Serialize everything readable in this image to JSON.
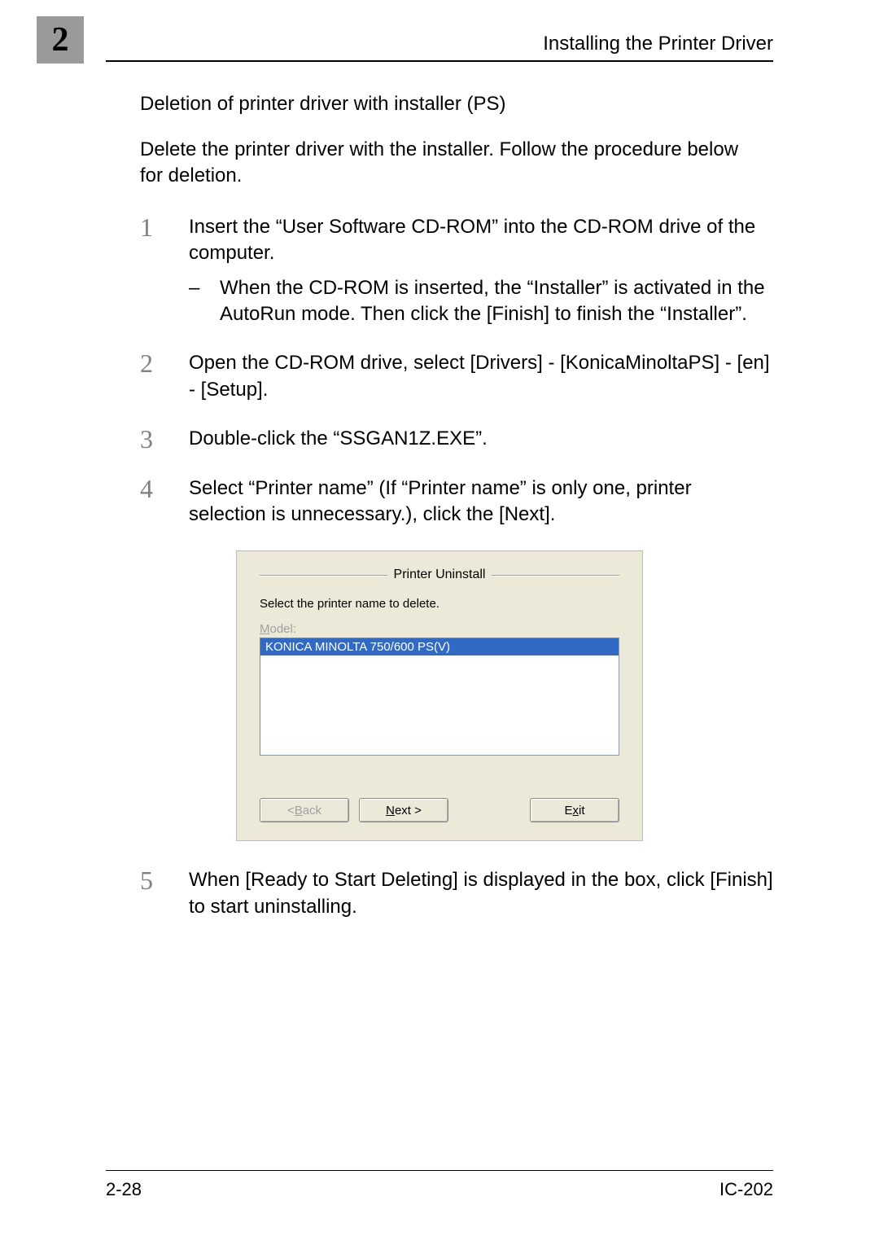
{
  "page_tab": "2",
  "header_title": "Installing the Printer Driver",
  "section_title": "Deletion of printer driver with installer (PS)",
  "intro": "Delete the printer driver with the installer. Follow the procedure below for deletion.",
  "steps": [
    {
      "num": "1",
      "text": "Insert the “User Software CD-ROM” into the CD-ROM drive of the computer.",
      "sub": "When the CD-ROM is inserted, the “Installer” is activated in the AutoRun mode. Then click the [Finish] to finish the “Installer”."
    },
    {
      "num": "2",
      "text": "Open the CD-ROM drive, select [Drivers] - [KonicaMinoltaPS] - [en] - [Setup]."
    },
    {
      "num": "3",
      "text": "Double-click the “SSGAN1Z.EXE”."
    },
    {
      "num": "4",
      "text": "Select “Printer name” (If “Printer name” is only one, printer selection is unnecessary.), click the [Next]."
    }
  ],
  "step5": {
    "num": "5",
    "text": "When [Ready to Start Deleting] is displayed in the box, click [Finish] to start uninstalling."
  },
  "dialog": {
    "title": "Printer Uninstall",
    "subtitle": "Select the printer name to delete.",
    "model_label_pre": "M",
    "model_label_post": "odel:",
    "selected_item": "KONICA MINOLTA 750/600 PS(V)",
    "back_pre": "< ",
    "back_u": "B",
    "back_post": "ack",
    "next_u": "N",
    "next_post": "ext >",
    "exit_pre": "E",
    "exit_u": "x",
    "exit_post": "it"
  },
  "footer": {
    "left": "2-28",
    "right": "IC-202"
  }
}
